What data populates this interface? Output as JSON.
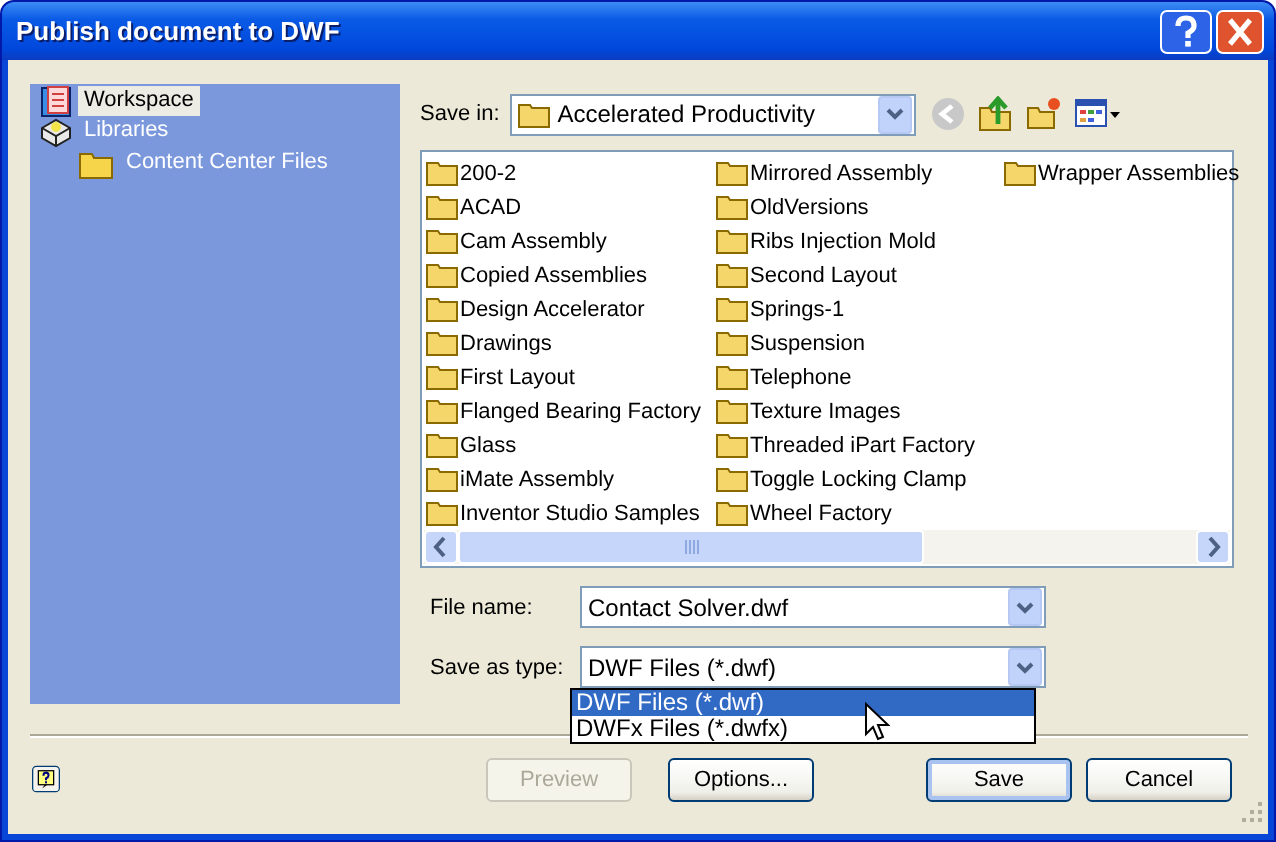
{
  "window": {
    "title": "Publish document to DWF"
  },
  "places": [
    {
      "label": "Workspace",
      "selected": true
    },
    {
      "label": "Libraries",
      "selected": false,
      "children": [
        {
          "label": "Content Center Files",
          "selected": false
        }
      ]
    }
  ],
  "save_in": {
    "label": "Save in:",
    "value": "Accelerated Productivity"
  },
  "toolbar": [
    {
      "kind": "back",
      "disabled": true
    },
    {
      "kind": "up",
      "disabled": false
    },
    {
      "kind": "new_folder",
      "disabled": false
    },
    {
      "kind": "views",
      "disabled": false
    }
  ],
  "files": [
    "200-2",
    "ACAD",
    "Cam Assembly",
    "Copied Assemblies",
    "Design Accelerator",
    "Drawings",
    "First Layout",
    "Flanged Bearing Factory",
    "Glass",
    "iMate Assembly",
    "Inventor Studio Samples",
    "Mirrored Assembly",
    "OldVersions",
    "Ribs Injection Mold",
    "Second Layout",
    "Springs-1",
    "Suspension",
    "Telephone",
    "Texture Images",
    "Threaded iPart Factory",
    "Toggle Locking Clamp",
    "Wheel Factory",
    "Wrapper Assemblies"
  ],
  "file_name": {
    "label": "File name:",
    "value": "Contact Solver.dwf"
  },
  "save_as_type": {
    "label": "Save as type:",
    "value": "DWF Files (*.dwf)",
    "options": [
      {
        "label": "DWF Files (*.dwf)",
        "selected": true
      },
      {
        "label": "DWFx Files (*.dwfx)",
        "selected": false
      }
    ]
  },
  "buttons": [
    {
      "label": "Preview",
      "disabled": true,
      "default": false
    },
    {
      "label": "Options...",
      "disabled": false,
      "default": false
    },
    {
      "label": "Save",
      "disabled": false,
      "default": true
    },
    {
      "label": "Cancel",
      "disabled": false,
      "default": false
    }
  ]
}
